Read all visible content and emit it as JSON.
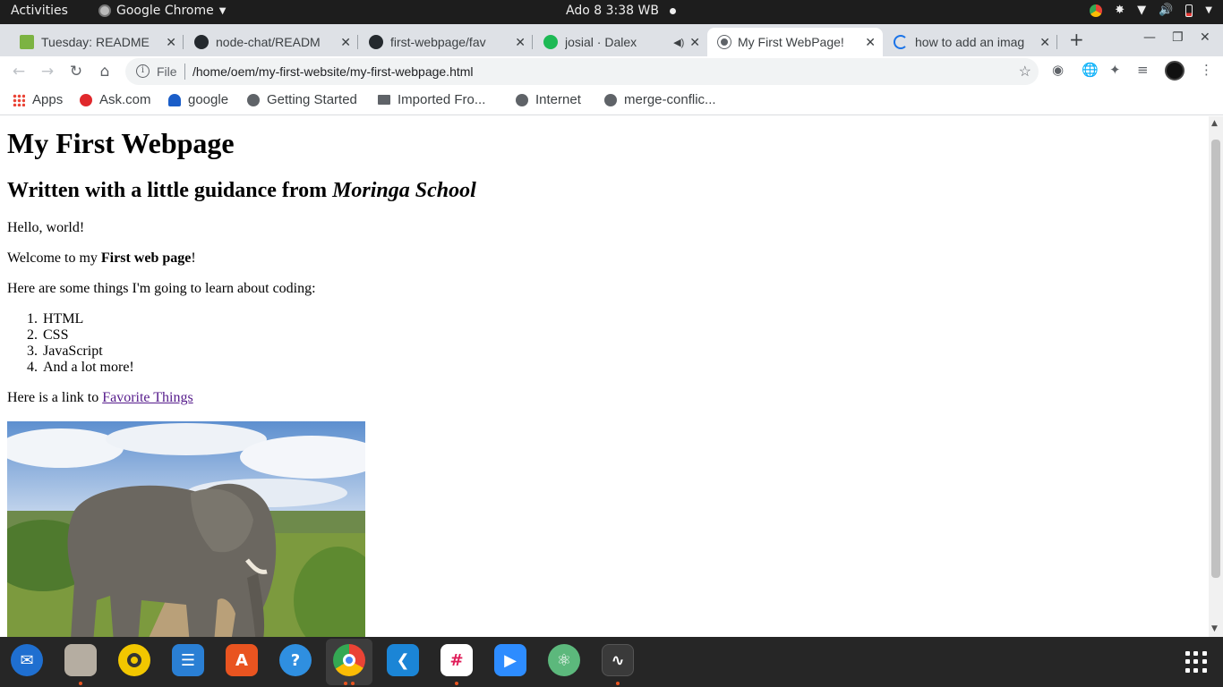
{
  "topbar": {
    "activities": "Activities",
    "app_name": "Google Chrome",
    "clock": "Ado 8  3:38 WB"
  },
  "tabs": [
    {
      "title": "Tuesday: README",
      "icon": "palm-tree-icon"
    },
    {
      "title": "node-chat/READM",
      "icon": "github-icon"
    },
    {
      "title": "first-webpage/fav",
      "icon": "github-icon"
    },
    {
      "title": "josial · Dalex",
      "icon": "spotify-icon"
    },
    {
      "title": "My First WebPage!",
      "icon": "globe-icon",
      "active": true
    },
    {
      "title": "how to add an imag",
      "icon": "loading-spinner-icon"
    }
  ],
  "omnibox": {
    "scheme_label": "File",
    "url": "/home/oem/my-first-website/my-first-webpage.html"
  },
  "bookmarks": [
    {
      "label": "Apps",
      "icon": "apps-grid-icon"
    },
    {
      "label": "Ask.com",
      "icon": "ask-icon"
    },
    {
      "label": "google",
      "icon": "google-hat-icon"
    },
    {
      "label": "Getting Started",
      "icon": "globe-icon"
    },
    {
      "label": "Imported Fro...",
      "icon": "folder-icon"
    },
    {
      "label": "Internet",
      "icon": "globe-icon"
    },
    {
      "label": "merge-conflic...",
      "icon": "globe-icon"
    }
  ],
  "page": {
    "heading": "My First Webpage",
    "subheading_prefix": "Written with a little guidance from ",
    "subheading_em": "Moringa School",
    "hello": "Hello, world!",
    "welcome_prefix": "Welcome to my ",
    "welcome_bold": "First web page",
    "welcome_suffix": "!",
    "learn_intro": "Here are some things I'm going to learn about coding:",
    "learn_list": [
      {
        "num": "1.",
        "text": "HTML"
      },
      {
        "num": "2.",
        "text": "CSS"
      },
      {
        "num": "3.",
        "text": "JavaScript"
      },
      {
        "num": "4.",
        "text": "And a lot more!"
      }
    ],
    "link_prefix": "Here is a link to ",
    "link_text": "Favorite Things",
    "image_subject": "elephant-photo"
  },
  "dock": [
    {
      "name": "thunderbird-icon",
      "color": "#1f6fd0"
    },
    {
      "name": "files-icon",
      "color": "#b5ada1"
    },
    {
      "name": "rhythmbox-icon",
      "color": "#f2c700"
    },
    {
      "name": "libreoffice-writer-icon",
      "color": "#2a7fd4"
    },
    {
      "name": "software-center-icon",
      "color": "#e95420"
    },
    {
      "name": "help-icon",
      "color": "#2f8fe0"
    },
    {
      "name": "chrome-icon",
      "color": "#e53935"
    },
    {
      "name": "vscode-icon",
      "color": "#1b85d6"
    },
    {
      "name": "slack-icon",
      "color": "#ffffff"
    },
    {
      "name": "zoom-icon",
      "color": "#2d8cff"
    },
    {
      "name": "atom-icon",
      "color": "#5cb87c"
    },
    {
      "name": "system-monitor-icon",
      "color": "#3a3a3a"
    }
  ]
}
